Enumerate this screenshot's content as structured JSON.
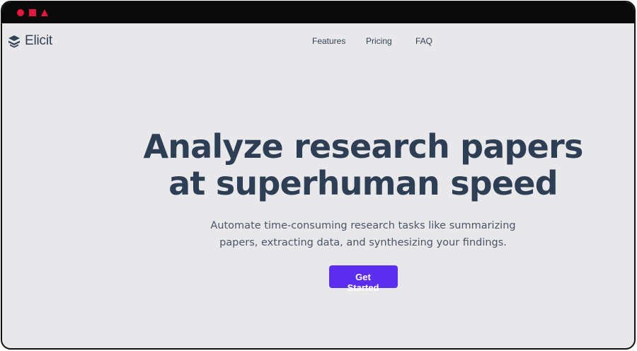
{
  "window_controls": [
    {
      "shape": "circle",
      "color": "#e5173f"
    },
    {
      "shape": "square",
      "color": "#e5173f"
    },
    {
      "shape": "triangle",
      "color": "#e5173f"
    }
  ],
  "brand": {
    "name": "Elicit",
    "icon": "elicit-logo-icon"
  },
  "nav": {
    "items": [
      {
        "label": "Features"
      },
      {
        "label": "Pricing"
      },
      {
        "label": "FAQ"
      }
    ]
  },
  "hero": {
    "headline_line1": "Analyze research papers",
    "headline_line2": "at superhuman speed",
    "subtext_line1": "Automate time-consuming research tasks like summarizing",
    "subtext_line2": "papers, extracting data, and synthesizing your findings.",
    "cta_label": "Get Started"
  },
  "colors": {
    "accent": "#5b2ef2",
    "heading": "#2e3e54",
    "background": "#e8e8eb",
    "window_controls": "#e5173f"
  }
}
